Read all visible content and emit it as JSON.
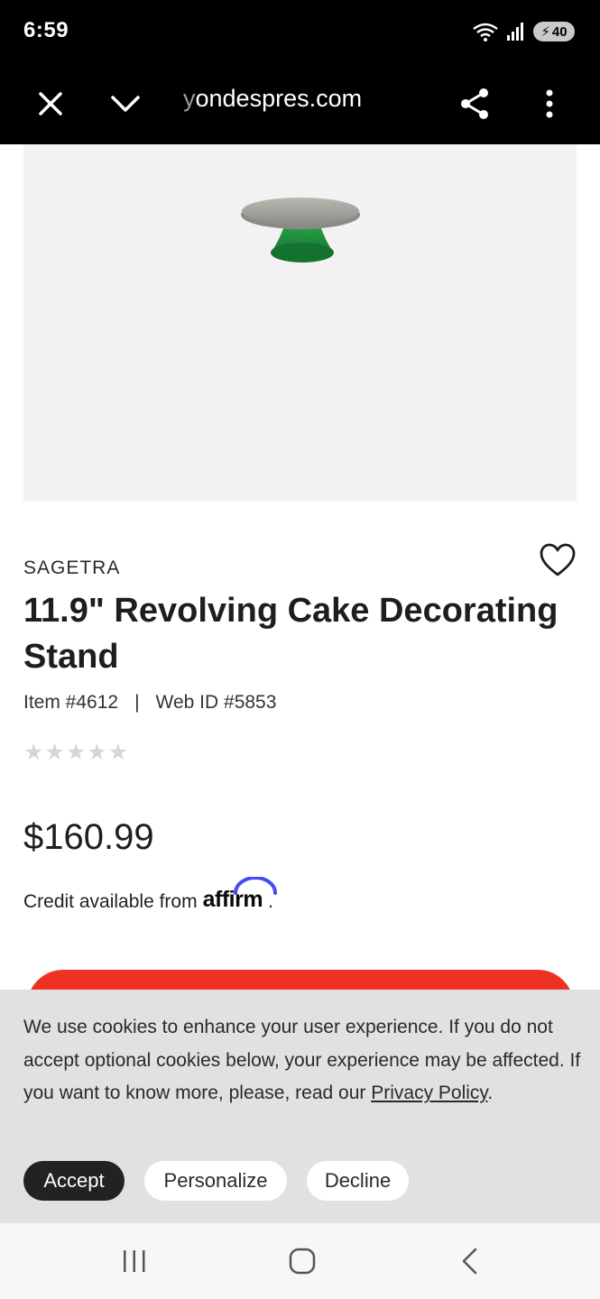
{
  "status_bar": {
    "time": "6:59",
    "battery_level": "40",
    "icons": [
      "wifi-icon",
      "signal-icon",
      "battery-icon"
    ]
  },
  "browser": {
    "url_prefix": "y",
    "url_main": "ondespres.com",
    "icons": [
      "close-icon",
      "chevron-down-icon",
      "share-icon",
      "more-vert-icon"
    ]
  },
  "product": {
    "brand": "SAGETRA",
    "title": "11.9\" Revolving Cake Decorating Stand",
    "item_number": "Item #4612",
    "separator": "|",
    "web_id": "Web ID #5853",
    "rating": 0,
    "rating_max": 5,
    "price": "$160.99",
    "credit_text": "Credit available from",
    "credit_brand": "affirm",
    "credit_suffix": "."
  },
  "cookie": {
    "text": "We use cookies to enhance your user experience. If you do not accept optional cookies below, your experience may be affected. If you want to know more, please, read our",
    "link": "Privacy Policy",
    "link_suffix": ".",
    "accept_label": "Accept",
    "personalize_label": "Personalize",
    "decline_label": "Decline"
  },
  "colors": {
    "cta": "#ef3124",
    "affirm_arc": "#4a4af4",
    "stand_green": "#1f8a3a"
  }
}
